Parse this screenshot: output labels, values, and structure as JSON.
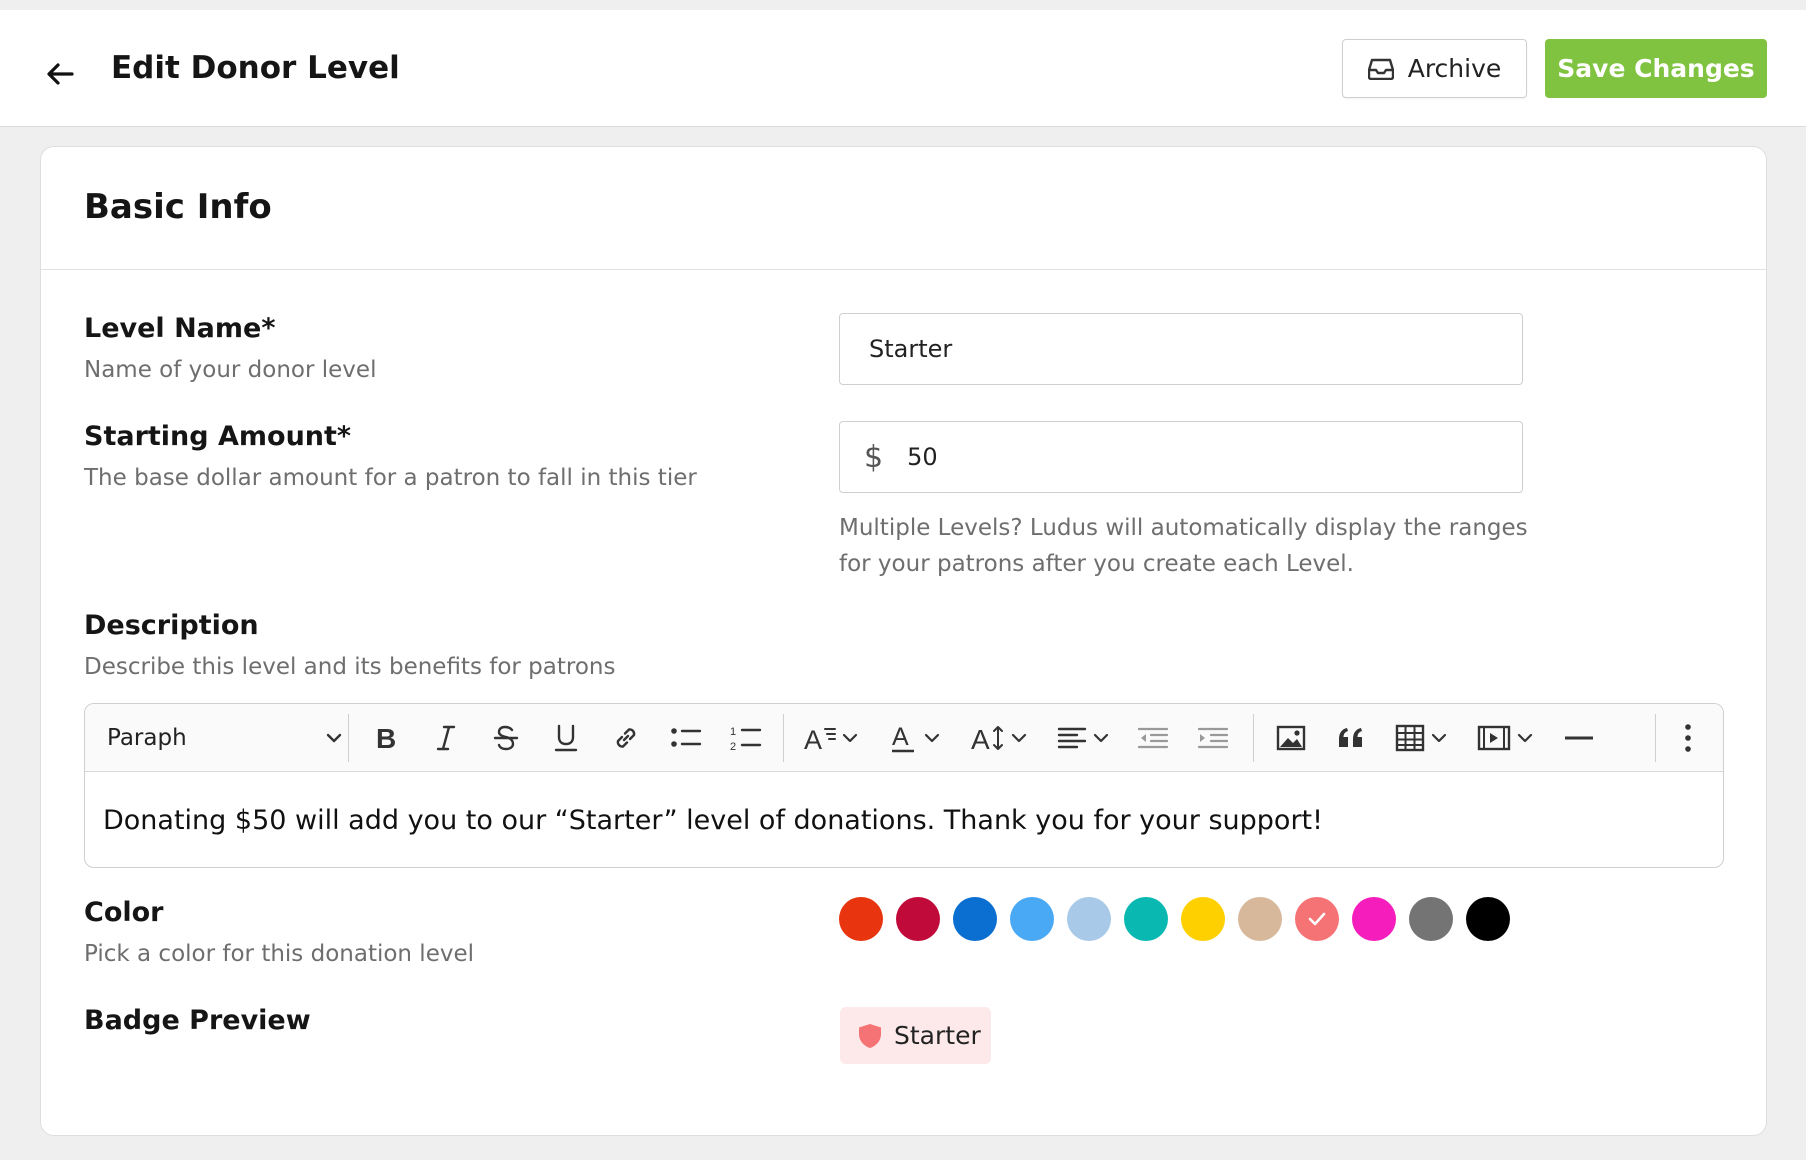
{
  "header": {
    "title": "Edit Donor Level",
    "archive_label": "Archive",
    "save_label": "Save Changes"
  },
  "card": {
    "title": "Basic Info"
  },
  "fields": {
    "level_name": {
      "label": "Level Name*",
      "description": "Name of your donor level",
      "value": "Starter"
    },
    "starting_amount": {
      "label": "Starting Amount*",
      "description": "The base dollar amount for a patron to fall in this tier",
      "currency_symbol": "$",
      "value": "50",
      "help_line1": "Multiple Levels? Ludus will automatically display the ranges",
      "help_line2": "for your patrons after you create each Level."
    },
    "description": {
      "label": "Description",
      "description": "Describe this level and its benefits for patrons",
      "block_format": "Paraph",
      "content": "Donating $50 will add you to our “Starter” level of donations. Thank you for your support!"
    },
    "color": {
      "label": "Color",
      "description": "Pick a color for this donation level",
      "options": [
        "#e8340f",
        "#c00a3a",
        "#0a6fd1",
        "#4aa9f5",
        "#a8c9e8",
        "#0ab8b2",
        "#ffd000",
        "#d8b89b",
        "#f57375",
        "#f51ebc",
        "#747474",
        "#000000"
      ],
      "selected_index": 8
    },
    "badge_preview": {
      "label": "Badge Preview",
      "text": "Starter",
      "color": "#f57375"
    }
  },
  "toolbar_icons": [
    "bold-icon",
    "italic-icon",
    "strikethrough-icon",
    "underline-icon",
    "link-icon",
    "bulleted-list-icon",
    "numbered-list-icon",
    "font-size-icon",
    "font-color-icon",
    "text-height-icon",
    "align-icon",
    "outdent-icon",
    "indent-icon",
    "image-icon",
    "quote-icon",
    "table-icon",
    "media-icon",
    "horizontal-line-icon",
    "more-options-icon"
  ]
}
